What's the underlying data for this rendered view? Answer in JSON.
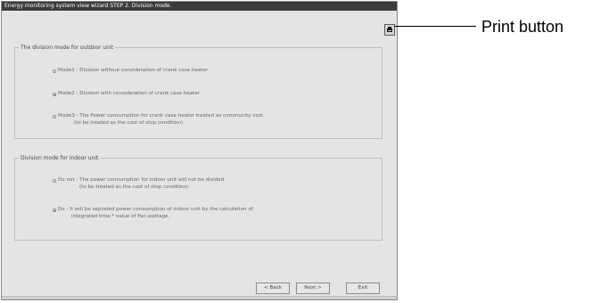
{
  "window": {
    "title": "Energy monitoring system view wizard   STEP 2. Division mode."
  },
  "outdoor": {
    "legend": "The division mode for outdoor unit",
    "options": [
      {
        "line1": "Mode1 : Division without consideration of crank case heater",
        "line2": "",
        "selected": false
      },
      {
        "line1": "Mode2 : Division with consideration of crank case heater",
        "line2": "",
        "selected": true
      },
      {
        "line1": "Mode3 : The Power consumption for crank case heater treated as community cost.",
        "line2": "(to be treated as the cost of stop condition)",
        "selected": false
      }
    ]
  },
  "indoor": {
    "legend": "Division mode for indoor unit",
    "options": [
      {
        "line1": "Do not : The power consumption for indoor unit will not be divided.",
        "line2": "(to be treated as the cost of stop condition)",
        "selected": false
      },
      {
        "line1": "Do : It will be seprated power consumption of indoor unit by the calculation of",
        "line2": "integrated time * value of Fan wattage.",
        "selected": true
      }
    ]
  },
  "buttons": {
    "back": "< Back",
    "next": "Next >",
    "exit": "Exit"
  },
  "annotation": {
    "print_label": "Print button"
  }
}
